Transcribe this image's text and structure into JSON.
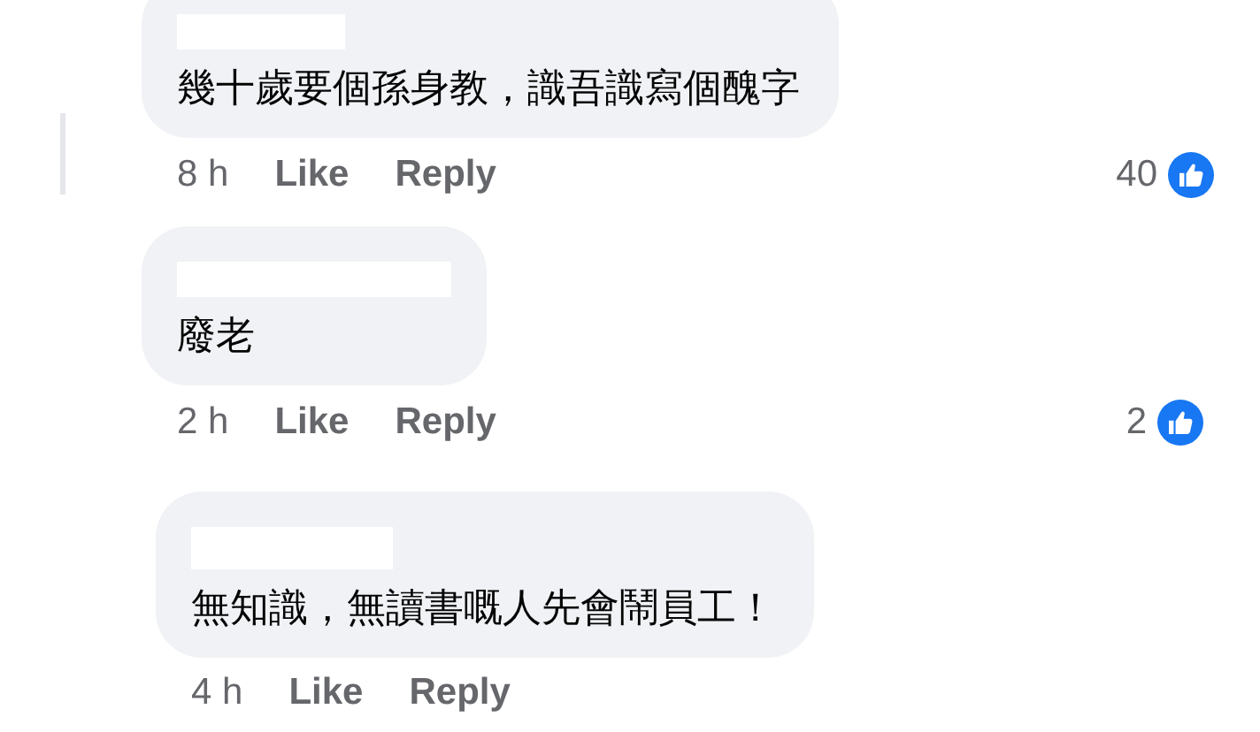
{
  "comments": [
    {
      "text": "幾十歲要個孫身教，識吾識寫個醜字",
      "time": "8 h",
      "like": "Like",
      "reply": "Reply",
      "reactions": "40"
    },
    {
      "text": "廢老",
      "time": "2 h",
      "like": "Like",
      "reply": "Reply",
      "reactions": "2"
    },
    {
      "text": "無知識，無讀書嘅人先會鬧員工！",
      "time": "4 h",
      "like": "Like",
      "reply": "Reply"
    }
  ]
}
